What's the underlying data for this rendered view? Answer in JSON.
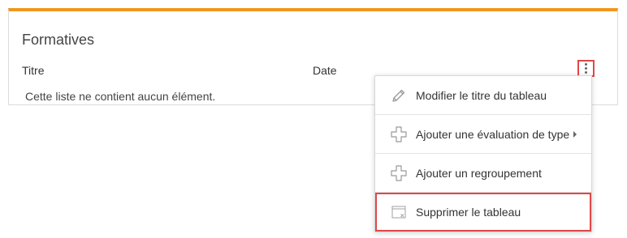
{
  "panel": {
    "title": "Formatives",
    "accent_color": "#f0961e",
    "columns": {
      "titre": "Titre",
      "date": "Date"
    },
    "empty_message": "Cette liste ne contient aucun élément."
  },
  "menu": {
    "items": [
      {
        "label": "Modifier le titre du tableau",
        "icon": "pencil-icon"
      },
      {
        "label": "Ajouter une évaluation de type",
        "icon": "plus-icon",
        "has_submenu": true
      },
      {
        "label": "Ajouter un regroupement",
        "icon": "plus-icon"
      },
      {
        "label": "Supprimer le tableau",
        "icon": "delete-table-icon",
        "highlighted": true
      }
    ]
  },
  "highlight_color": "#e04848"
}
